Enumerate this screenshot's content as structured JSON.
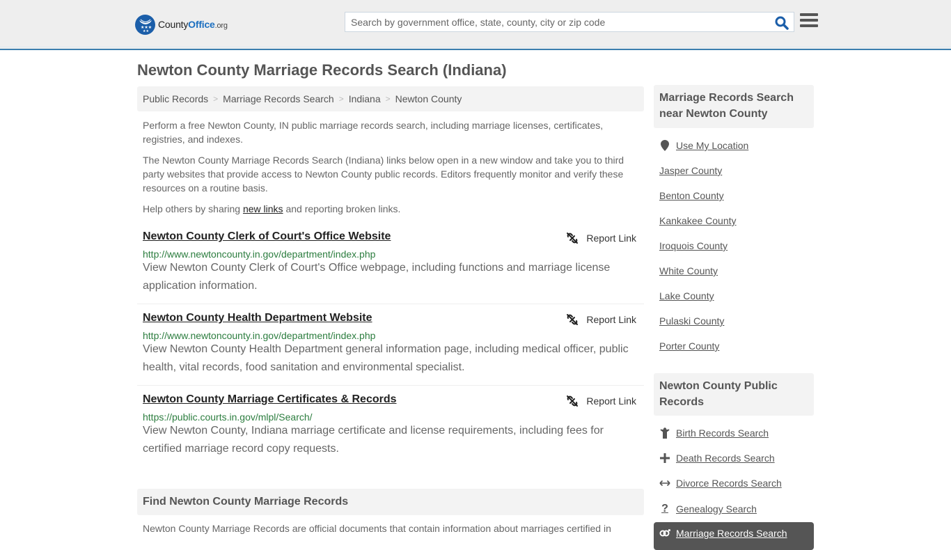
{
  "header": {
    "logo": {
      "part1": "County",
      "part2": "Office",
      "part3": ".org"
    },
    "search": {
      "placeholder": "Search by government office, state, county, city or zip code",
      "value": ""
    },
    "colors": {
      "accent": "#3b7eae",
      "brand_blue": "#1b5ea9",
      "url_green": "#2c7d3f"
    }
  },
  "page": {
    "title": "Newton County Marriage Records Search (Indiana)"
  },
  "breadcrumb": [
    {
      "label": "Public Records"
    },
    {
      "label": "Marriage Records Search"
    },
    {
      "label": "Indiana"
    },
    {
      "label": "Newton County"
    }
  ],
  "intro": {
    "p1": "Perform a free Newton County, IN public marriage records search, including marriage licenses, certificates, registries, and indexes.",
    "p2": "The Newton County Marriage Records Search (Indiana) links below open in a new window and take you to third party websites that provide access to Newton County public records. Editors frequently monitor and verify these resources on a routine basis.",
    "p3_before": "Help others by sharing ",
    "p3_link": "new links",
    "p3_after": " and reporting broken links."
  },
  "results": [
    {
      "title": "Newton County Clerk of Court's Office Website",
      "url": "http://www.newtoncounty.in.gov/department/index.php",
      "description": "View Newton County Clerk of Court's Office webpage, including functions and marriage license application information.",
      "report_label": "Report Link"
    },
    {
      "title": "Newton County Health Department Website",
      "url": "http://www.newtoncounty.in.gov/department/index.php",
      "description": "View Newton County Health Department general information page, including medical officer, public health, vital records, food sanitation and environmental specialist.",
      "report_label": "Report Link"
    },
    {
      "title": "Newton County Marriage Certificates & Records",
      "url": "https://public.courts.in.gov/mlpl/Search/",
      "description": "View Newton County, Indiana marriage certificate and license requirements, including fees for certified marriage record copy requests.",
      "report_label": "Report Link"
    }
  ],
  "find_section": {
    "heading": "Find Newton County Marriage Records",
    "text": "Newton County Marriage Records are official documents that contain information about marriages certified in"
  },
  "sidebar": {
    "nearby": {
      "heading": "Marriage Records Search near Newton County",
      "use_location": {
        "label": "Use My Location",
        "icon": "map-pin-icon"
      },
      "counties": [
        "Jasper County",
        "Benton County",
        "Kankakee County",
        "Iroquois County",
        "White County",
        "Lake County",
        "Pulaski County",
        "Porter County"
      ]
    },
    "public_records": {
      "heading": "Newton County Public Records",
      "items": [
        {
          "label": "Birth Records Search",
          "icon": "child-icon"
        },
        {
          "label": "Death Records Search",
          "icon": "plus-cross-icon"
        },
        {
          "label": "Divorce Records Search",
          "icon": "arrows-horizontal-icon"
        },
        {
          "label": "Genealogy Search",
          "icon": "question-icon"
        },
        {
          "label": "Marriage Records Search",
          "icon": "venus-mars-icon",
          "active": true
        }
      ]
    }
  }
}
